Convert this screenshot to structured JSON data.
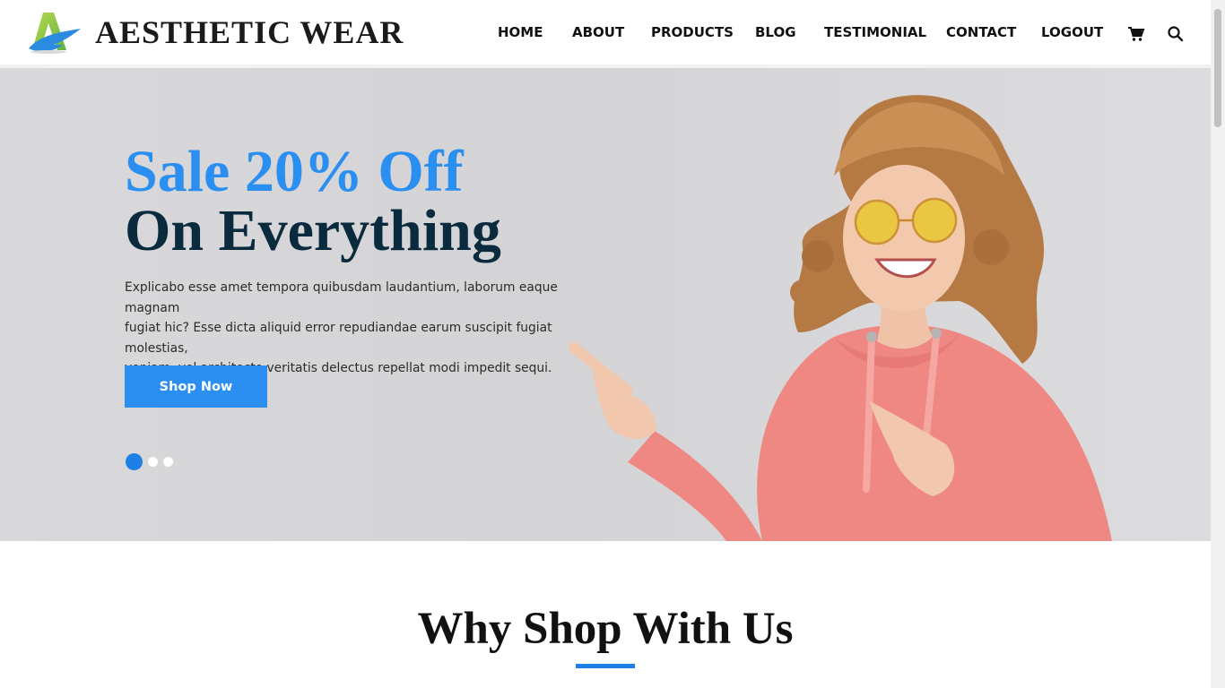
{
  "brand": {
    "name": "AESTHETIC WEAR",
    "logo_icon": "letter-a-logo",
    "accent_color": "#2a8ff0",
    "dark_color": "#0a2b3d"
  },
  "nav": {
    "items": [
      "HOME",
      "ABOUT",
      "PRODUCTS",
      "BLOG",
      "TESTIMONIAL",
      "CONTACT",
      "LOGOUT"
    ],
    "cart_icon": "cart-icon",
    "search_icon": "search-icon"
  },
  "hero": {
    "title_line1": "Sale 20% Off",
    "title_line2": "On Everything",
    "text_lines": [
      "Explicabo esse amet tempora quibusdam laudantium, laborum eaque magnam",
      "fugiat hic? Esse dicta aliquid error repudiandae earum suscipit fugiat molestias,",
      "veniam, vel architecto veritatis delectus repellat modi impedit sequi."
    ],
    "button_label": "Shop Now",
    "slides": 3,
    "active_slide": 1
  },
  "why": {
    "title": "Why Shop With Us"
  }
}
